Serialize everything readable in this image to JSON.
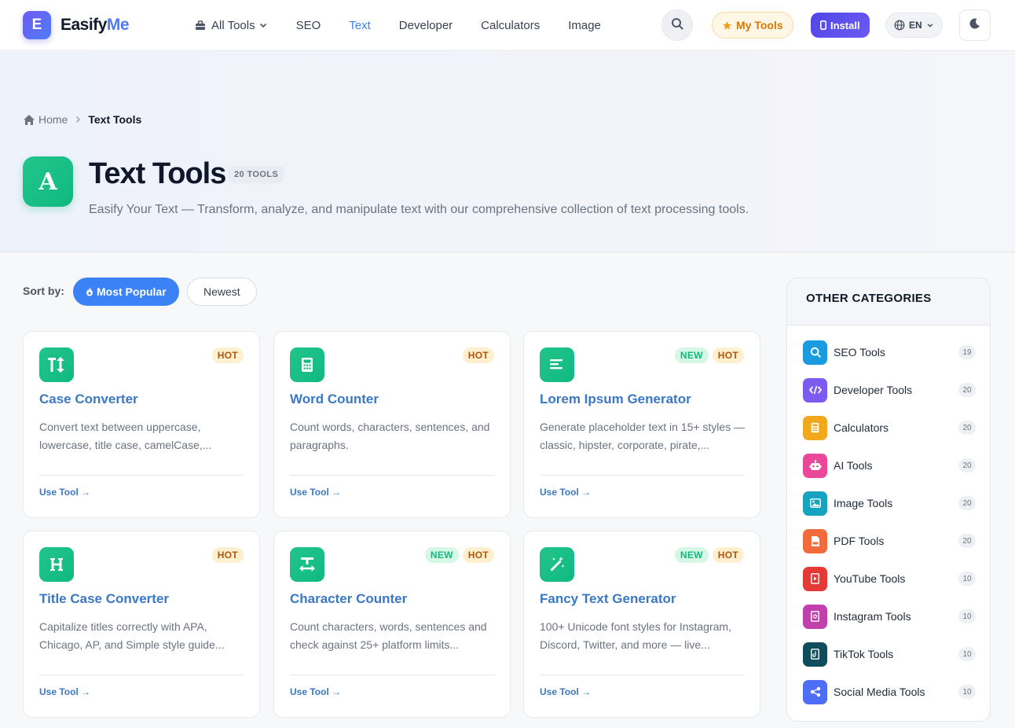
{
  "header": {
    "logo_letter": "E",
    "logo_name": "Easify",
    "logo_accent": "Me",
    "nav": [
      {
        "label": "All Tools"
      },
      {
        "label": "SEO"
      },
      {
        "label": "Text"
      },
      {
        "label": "Developer"
      },
      {
        "label": "Calculators"
      },
      {
        "label": "Image"
      }
    ],
    "my_tools": "My Tools",
    "install": "Install",
    "language": "EN"
  },
  "breadcrumb": {
    "home": "Home",
    "current": "Text Tools"
  },
  "hero": {
    "icon_letter": "A",
    "title": "Text Tools",
    "count": "20 TOOLS",
    "description": "Easify Your Text — Transform, analyze, and manipulate text with our comprehensive collection of text processing tools."
  },
  "sort": {
    "label": "Sort by:",
    "popular": "Most Popular",
    "newest": "Newest"
  },
  "cards": [
    {
      "title": "Case Converter",
      "description": "Convert text between uppercase, lowercase, title case, camelCase,...",
      "badges": [
        "HOT"
      ],
      "icon": "text-height-icon",
      "cta": "Use Tool →"
    },
    {
      "title": "Word Counter",
      "description": "Count words, characters, sentences, and paragraphs.",
      "badges": [
        "HOT"
      ],
      "icon": "calculator-icon",
      "cta": "Use Tool →"
    },
    {
      "title": "Lorem Ipsum Generator",
      "description": "Generate placeholder text in 15+ styles — classic, hipster, corporate, pirate,...",
      "badges": [
        "NEW",
        "HOT"
      ],
      "icon": "align-left-icon",
      "cta": "Use Tool →"
    },
    {
      "title": "Title Case Converter",
      "description": "Capitalize titles correctly with APA, Chicago, AP, and Simple style guide...",
      "badges": [
        "HOT"
      ],
      "icon": "heading-icon",
      "cta": "Use Tool →"
    },
    {
      "title": "Character Counter",
      "description": "Count characters, words, sentences and check against 25+ platform limits...",
      "badges": [
        "NEW",
        "HOT"
      ],
      "icon": "text-width-icon",
      "cta": "Use Tool →"
    },
    {
      "title": "Fancy Text Generator",
      "description": "100+ Unicode font styles for Instagram, Discord, Twitter, and more — live...",
      "badges": [
        "NEW",
        "HOT"
      ],
      "icon": "magic-wand-icon",
      "cta": "Use Tool →"
    }
  ],
  "sidebar": {
    "title": "OTHER CATEGORIES",
    "categories": [
      {
        "label": "SEO Tools",
        "count": "19",
        "color": "#1a9be0",
        "icon": "search-icon"
      },
      {
        "label": "Developer Tools",
        "count": "20",
        "color": "#7c5cf0",
        "icon": "code-icon"
      },
      {
        "label": "Calculators",
        "count": "20",
        "color": "#f2a81d",
        "icon": "calculator-icon"
      },
      {
        "label": "AI Tools",
        "count": "20",
        "color": "#ec4899",
        "icon": "robot-icon"
      },
      {
        "label": "Image Tools",
        "count": "20",
        "color": "#17a3bf",
        "icon": "image-icon"
      },
      {
        "label": "PDF Tools",
        "count": "20",
        "color": "#f26b3a",
        "icon": "pdf-icon"
      },
      {
        "label": "YouTube Tools",
        "count": "10",
        "color": "#e53935",
        "icon": "youtube-icon"
      },
      {
        "label": "Instagram Tools",
        "count": "10",
        "color": "#c23fae",
        "icon": "instagram-icon"
      },
      {
        "label": "TikTok Tools",
        "count": "10",
        "color": "#0f4c5c",
        "icon": "tiktok-icon"
      },
      {
        "label": "Social Media Tools",
        "count": "10",
        "color": "#4f6ef7",
        "icon": "share-icon"
      }
    ]
  }
}
